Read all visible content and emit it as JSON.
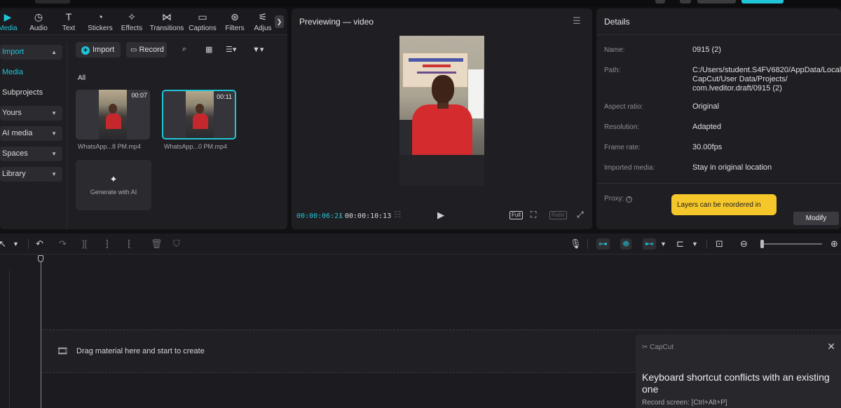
{
  "tabs": [
    {
      "label": "Media",
      "icon": "media-icon"
    },
    {
      "label": "Audio",
      "icon": "audio-icon"
    },
    {
      "label": "Text",
      "icon": "text-icon"
    },
    {
      "label": "Stickers",
      "icon": "stickers-icon"
    },
    {
      "label": "Effects",
      "icon": "effects-icon"
    },
    {
      "label": "Transitions",
      "icon": "transitions-icon"
    },
    {
      "label": "Captions",
      "icon": "captions-icon"
    },
    {
      "label": "Filters",
      "icon": "filters-icon"
    },
    {
      "label": "Adjus",
      "icon": "adjustment-icon"
    }
  ],
  "sidebar": {
    "items": [
      {
        "label": "Import"
      },
      {
        "label": "Media"
      },
      {
        "label": "Subprojects"
      },
      {
        "label": "Yours"
      },
      {
        "label": "AI media"
      },
      {
        "label": "Spaces"
      },
      {
        "label": "Library"
      }
    ]
  },
  "media": {
    "import_label": "Import",
    "record_label": "Record",
    "filter_label": "All",
    "clips": [
      {
        "duration": "00:07",
        "name": "WhatsApp...8 PM.mp4"
      },
      {
        "duration": "00:11",
        "name": "WhatsApp...0 PM.mp4"
      }
    ],
    "generate_label": "Generate with AI"
  },
  "preview": {
    "title": "Previewing — video",
    "current_time": "00:00:06:21",
    "separator": "/",
    "total_time": "00:00:10:13",
    "full_label": "Full",
    "ratio_label": "Ratio"
  },
  "details": {
    "title": "Details",
    "fields": [
      {
        "key": "Name:",
        "value": "0915 (2)"
      },
      {
        "key": "Path:",
        "value": "C:/Users/student.S4FV6820/AppData/Local/"
      },
      {
        "key": "Aspect ratio:",
        "value": "Original"
      },
      {
        "key": "Resolution:",
        "value": "Adapted"
      },
      {
        "key": "Frame rate:",
        "value": "30.00fps"
      },
      {
        "key": "Imported media:",
        "value": "Stay in original location"
      },
      {
        "key": "Proxy:",
        "value": ""
      }
    ],
    "path_line2": "CapCut/User Data/Projects/",
    "path_line3": "com.lveditor.draft/0915 (2)",
    "tooltip": "Layers can be reordered in",
    "modify_label": "Modify"
  },
  "timeline": {
    "drop_hint": "Drag material here and start to create"
  },
  "notification": {
    "app": "CapCut",
    "title": "Keyboard shortcut conflicts with an existing one",
    "subtitle": "Record screen: [Ctrl+Alt+P]"
  },
  "colors": {
    "accent": "#20c5d8",
    "panel": "#1f1f23",
    "background": "#111114",
    "tooltip": "#f5c72b"
  }
}
